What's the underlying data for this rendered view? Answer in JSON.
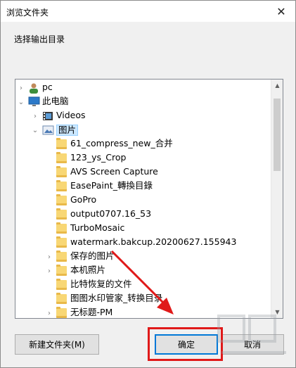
{
  "dialog": {
    "title": "浏览文件夹",
    "close_glyph": "✕",
    "prompt": "选择输出目录"
  },
  "tree": {
    "items": [
      {
        "label": "pc",
        "icon": "user-icon",
        "expander": "›",
        "selected": false
      },
      {
        "label": "此电脑",
        "icon": "computer-icon",
        "expander": "⌄",
        "selected": false
      },
      {
        "label": "Videos",
        "icon": "video-folder-icon",
        "expander": "›",
        "selected": false
      },
      {
        "label": "图片",
        "icon": "pictures-folder-icon",
        "expander": "⌄",
        "selected": true
      },
      {
        "label": "61_compress_new_合并",
        "icon": "folder-icon",
        "expander": "",
        "selected": false
      },
      {
        "label": "123_ys_Crop",
        "icon": "folder-icon",
        "expander": "",
        "selected": false
      },
      {
        "label": "AVS Screen Capture",
        "icon": "folder-icon",
        "expander": "",
        "selected": false
      },
      {
        "label": "EasePaint_轉換目錄",
        "icon": "folder-icon",
        "expander": "",
        "selected": false
      },
      {
        "label": "GoPro",
        "icon": "folder-icon",
        "expander": "",
        "selected": false
      },
      {
        "label": "output0707.16_53",
        "icon": "folder-icon",
        "expander": "",
        "selected": false
      },
      {
        "label": "TurboMosaic",
        "icon": "folder-icon",
        "expander": "",
        "selected": false
      },
      {
        "label": "watermark.bakcup.20200627.155943",
        "icon": "folder-icon",
        "expander": "",
        "selected": false
      },
      {
        "label": "保存的图片",
        "icon": "folder-icon",
        "expander": "›",
        "selected": false
      },
      {
        "label": "本机照片",
        "icon": "folder-icon",
        "expander": "›",
        "selected": false
      },
      {
        "label": "比特恢复的文件",
        "icon": "folder-icon",
        "expander": "",
        "selected": false
      },
      {
        "label": "图图水印管家_转换目录",
        "icon": "folder-icon",
        "expander": "",
        "selected": false
      },
      {
        "label": "无标题-PM",
        "icon": "folder-icon",
        "expander": "›",
        "selected": false
      }
    ]
  },
  "buttons": {
    "new_folder": "新建文件夹(M)",
    "ok": "确定",
    "cancel": "取消"
  },
  "colors": {
    "highlight": "#e01919",
    "selection": "#cce8ff",
    "accent": "#0078d7"
  }
}
